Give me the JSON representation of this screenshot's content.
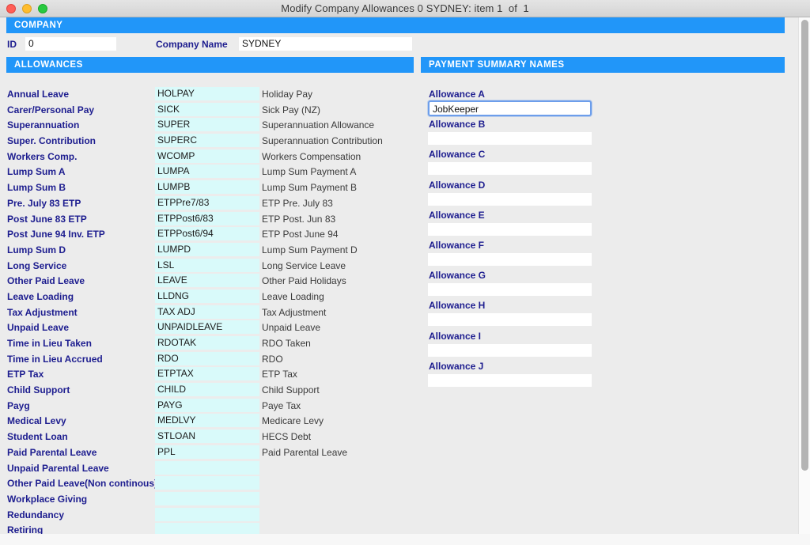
{
  "window": {
    "title": "Modify Company Allowances 0 SYDNEY: item 1  of  1",
    "traffic_lights": [
      "close",
      "minimize",
      "maximize"
    ],
    "accent_blue": "#2196f9",
    "label_navy": "#1d1d8f",
    "code_field_bg": "#d9fafa",
    "focus_ring": "#6d9eeb"
  },
  "company": {
    "section_title": "COMPANY",
    "id_label": "ID",
    "id_value": "0",
    "name_label": "Company Name",
    "name_value": "SYDNEY"
  },
  "allowances": {
    "section_title": "ALLOWANCES",
    "rows": [
      {
        "name": "Annual Leave",
        "code": "HOLPAY",
        "desc": "Holiday Pay"
      },
      {
        "name": "Carer/Personal Pay",
        "code": "SICK",
        "desc": "Sick Pay (NZ)"
      },
      {
        "name": "Superannuation",
        "code": "SUPER",
        "desc": "Superannuation Allowance"
      },
      {
        "name": "Super. Contribution",
        "code": "SUPERC",
        "desc": "Superannuation Contribution"
      },
      {
        "name": "Workers Comp.",
        "code": "WCOMP",
        "desc": "Workers Compensation"
      },
      {
        "name": "Lump Sum A",
        "code": "LUMPA",
        "desc": "Lump Sum Payment A"
      },
      {
        "name": "Lump Sum B",
        "code": "LUMPB",
        "desc": "Lump Sum Payment B"
      },
      {
        "name": "Pre. July 83 ETP",
        "code": "ETPPre7/83",
        "desc": "ETP Pre. July 83"
      },
      {
        "name": "Post June 83 ETP",
        "code": "ETPPost6/83",
        "desc": "ETP Post. Jun 83"
      },
      {
        "name": "Post June 94 Inv. ETP",
        "code": "ETPPost6/94",
        "desc": "ETP Post June 94"
      },
      {
        "name": "Lump Sum D",
        "code": "LUMPD",
        "desc": "Lump Sum Payment D"
      },
      {
        "name": "Long Service",
        "code": "LSL",
        "desc": "Long Service Leave"
      },
      {
        "name": "Other Paid Leave",
        "code": "LEAVE",
        "desc": "Other Paid Holidays"
      },
      {
        "name": "Leave Loading",
        "code": "LLDNG",
        "desc": "Leave Loading"
      },
      {
        "name": "Tax Adjustment",
        "code": "TAX ADJ",
        "desc": "Tax Adjustment"
      },
      {
        "name": "Unpaid Leave",
        "code": "UNPAIDLEAVE",
        "desc": "Unpaid Leave"
      },
      {
        "name": "Time in Lieu Taken",
        "code": "RDOTAK",
        "desc": "RDO Taken"
      },
      {
        "name": "Time in Lieu Accrued",
        "code": "RDO",
        "desc": "RDO"
      },
      {
        "name": "ETP Tax",
        "code": "ETPTAX",
        "desc": "ETP Tax"
      },
      {
        "name": "Child Support",
        "code": "CHILD",
        "desc": "Child Support"
      },
      {
        "name": "Payg",
        "code": "PAYG",
        "desc": "Paye Tax"
      },
      {
        "name": "Medical Levy",
        "code": "MEDLVY",
        "desc": "Medicare Levy"
      },
      {
        "name": "Student Loan",
        "code": "STLOAN",
        "desc": "HECS Debt"
      },
      {
        "name": "Paid Parental Leave",
        "code": "PPL",
        "desc": "Paid Parental Leave"
      },
      {
        "name": "Unpaid Parental Leave",
        "code": "",
        "desc": ""
      },
      {
        "name": "Other Paid Leave(Non continous)",
        "code": "",
        "desc": ""
      },
      {
        "name": "Workplace Giving",
        "code": "",
        "desc": ""
      },
      {
        "name": "Redundancy",
        "code": "",
        "desc": ""
      },
      {
        "name": "Retiring",
        "code": "",
        "desc": ""
      }
    ]
  },
  "payment_summary_names": {
    "section_title": "PAYMENT SUMMARY NAMES",
    "fields": [
      {
        "label": "Allowance A",
        "value": "JobKeeper",
        "focused": true
      },
      {
        "label": "Allowance B",
        "value": "",
        "focused": false
      },
      {
        "label": "Allowance C",
        "value": "",
        "focused": false
      },
      {
        "label": "Allowance D",
        "value": "",
        "focused": false
      },
      {
        "label": "Allowance E",
        "value": "",
        "focused": false
      },
      {
        "label": "Allowance F",
        "value": "",
        "focused": false
      },
      {
        "label": "Allowance G",
        "value": "",
        "focused": false
      },
      {
        "label": "Allowance H",
        "value": "",
        "focused": false
      },
      {
        "label": "Allowance I",
        "value": "",
        "focused": false
      },
      {
        "label": "Allowance J",
        "value": "",
        "focused": false
      }
    ]
  }
}
